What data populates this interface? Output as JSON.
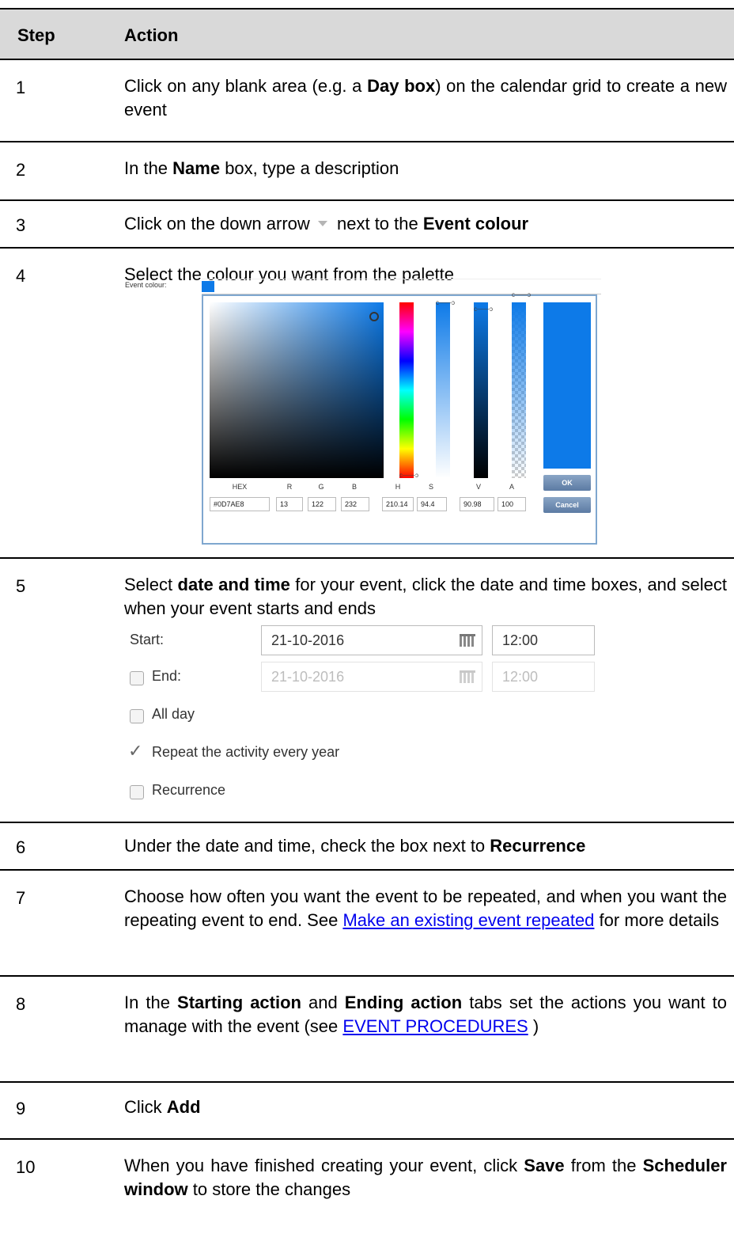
{
  "header": {
    "col_step": "Step",
    "col_action": "Action"
  },
  "steps": [
    {
      "num": "1",
      "t1": "Click on any blank area (e.g. a ",
      "b1": "Day box",
      "t2": ") on the calendar grid to create a new event"
    },
    {
      "num": "2",
      "t1": "In the ",
      "b1": "Name",
      "t2": " box, type a description"
    },
    {
      "num": "3",
      "t1": "Click on the down arrow ",
      "t2": " next to the ",
      "b1": "Event colour"
    },
    {
      "num": "4",
      "t1": "Select the colour you want from the palette"
    },
    {
      "num": "5",
      "t1": "Select ",
      "b1": "date and time",
      "t2": " for your event, click the date and time boxes, and select when your event starts and ends"
    },
    {
      "num": "6",
      "t1": "Under the date and time, check the box next to ",
      "b1": "Recurrence"
    },
    {
      "num": "7",
      "t1": "Choose how often you want the event to be repeated, and when you want the repeating event to end. See ",
      "link": "Make an existing event repeated",
      "t2": " for more details"
    },
    {
      "num": "8",
      "t1": "In the ",
      "b1": "Starting action",
      "t2": " and ",
      "b2": "Ending action",
      "t3": " tabs set the actions you want to manage with the event (see ",
      "link": "EVENT PROCEDURES",
      "t4": " )"
    },
    {
      "num": "9",
      "t1": "Click ",
      "b1": "Add"
    },
    {
      "num": "10",
      "t1": "When you have finished creating your event, click ",
      "b1": "Save",
      "t2": " from the ",
      "b2": "Scheduler window",
      "t3": " to store the changes"
    }
  ],
  "picker": {
    "event_colour_label": "Event colour:",
    "color": "#0D7AE8",
    "fields": [
      {
        "label": "HEX",
        "value": "#0D7AE8"
      },
      {
        "label": "R",
        "value": "13"
      },
      {
        "label": "G",
        "value": "122"
      },
      {
        "label": "B",
        "value": "232"
      },
      {
        "label": "H",
        "value": "210.14"
      },
      {
        "label": "S",
        "value": "94.4"
      },
      {
        "label": "V",
        "value": "90.98"
      },
      {
        "label": "A",
        "value": "100"
      }
    ],
    "ok": "OK",
    "cancel": "Cancel"
  },
  "datetime": {
    "start_label": "Start:",
    "start_date": "21-10-2016",
    "start_time": "12:00",
    "end_label": "End:",
    "end_date": "21-10-2016",
    "end_time": "12:00",
    "all_day": "All day",
    "repeat_year": "Repeat the activity every year",
    "recurrence": "Recurrence"
  }
}
